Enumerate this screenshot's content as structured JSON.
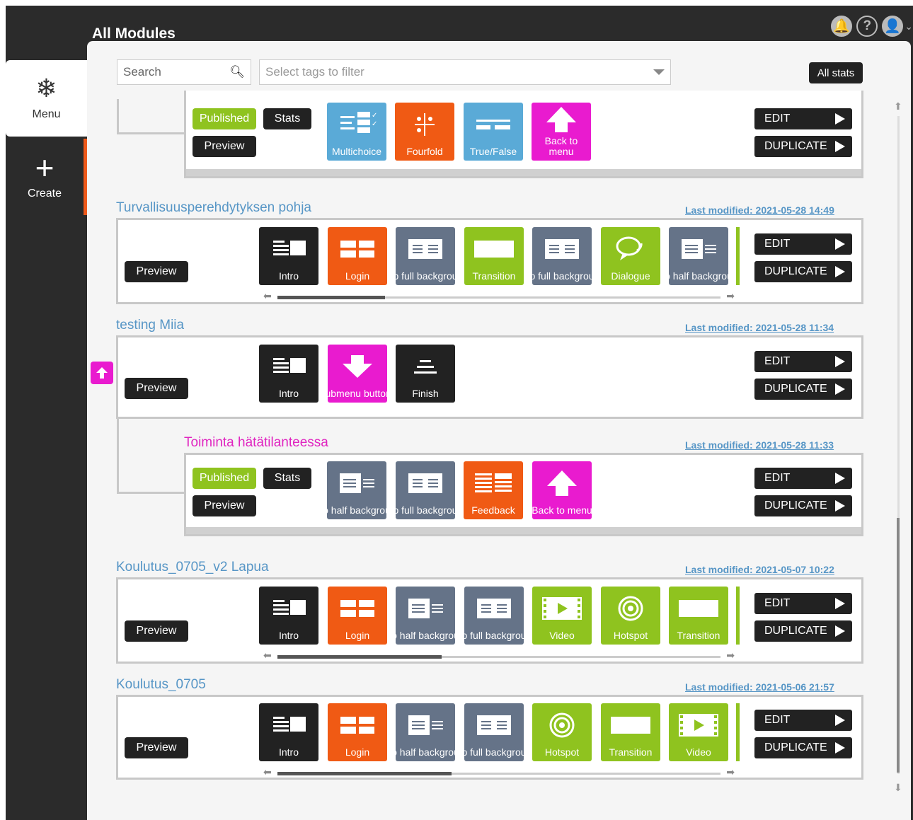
{
  "header": {
    "title": "All Modules"
  },
  "sidebar": {
    "menu_label": "Menu",
    "create_label": "Create"
  },
  "toolbar": {
    "search_placeholder": "Search",
    "tags_placeholder": "Select tags to filter",
    "all_stats": "All stats"
  },
  "common": {
    "edit": "EDIT",
    "duplicate": "DUPLICATE",
    "preview": "Preview",
    "published": "Published",
    "stats": "Stats"
  },
  "modules": [
    {
      "title": "",
      "tiles": [
        {
          "label": "Multichoice",
          "color": "#5aaad7"
        },
        {
          "label": "Fourfold",
          "color": "#f05a14"
        },
        {
          "label": "True/False",
          "color": "#5aaad7"
        },
        {
          "label": "Back to menu",
          "color": "#e91bcf"
        }
      ]
    },
    {
      "title": "Turvallisuusperehdytyksen pohja",
      "last_modified": "Last modified: 2021-05-28 14:49",
      "tiles": [
        {
          "label": "Intro"
        },
        {
          "label": "Login"
        },
        {
          "label": "Info full background"
        },
        {
          "label": "Transition"
        },
        {
          "label": "Info full background"
        },
        {
          "label": "Dialogue"
        },
        {
          "label": "Info half background"
        }
      ]
    },
    {
      "title": "testing Miia",
      "last_modified": "Last modified: 2021-05-28 11:34",
      "tiles": [
        {
          "label": "Intro"
        },
        {
          "label": "Submenu buttons"
        },
        {
          "label": "Finish"
        }
      ]
    },
    {
      "title": "Toiminta hätätilanteessa",
      "last_modified": "Last modified: 2021-05-28 11:33",
      "tiles": [
        {
          "label": "Info half background"
        },
        {
          "label": "Info full background"
        },
        {
          "label": "Feedback"
        },
        {
          "label": "Back to menu"
        }
      ]
    },
    {
      "title": "Koulutus_0705_v2 Lapua",
      "last_modified": "Last modified: 2021-05-07 10:22",
      "tiles": [
        {
          "label": "Intro"
        },
        {
          "label": "Login"
        },
        {
          "label": "Info half background"
        },
        {
          "label": "Info full background"
        },
        {
          "label": "Video"
        },
        {
          "label": "Hotspot"
        },
        {
          "label": "Transition"
        }
      ]
    },
    {
      "title": "Koulutus_0705",
      "last_modified": "Last modified: 2021-05-06 21:57",
      "tiles": [
        {
          "label": "Intro"
        },
        {
          "label": "Login"
        },
        {
          "label": "Info half background"
        },
        {
          "label": "Info full background"
        },
        {
          "label": "Hotspot"
        },
        {
          "label": "Transition"
        },
        {
          "label": "Video"
        }
      ]
    }
  ]
}
